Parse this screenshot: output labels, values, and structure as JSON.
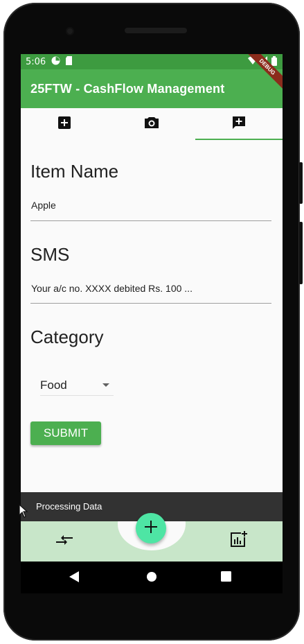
{
  "status_bar": {
    "time": "5:06",
    "icons": [
      "pie-icon",
      "sim-icon",
      "wifi-icon",
      "signal-icon",
      "battery-icon"
    ]
  },
  "app_bar": {
    "title": "25FTW - CashFlow Management",
    "debug_label": "DEBUG"
  },
  "tabs": [
    {
      "icon": "add-box-icon",
      "selected": false
    },
    {
      "icon": "camera-icon",
      "selected": false
    },
    {
      "icon": "add-comment-icon",
      "selected": true
    }
  ],
  "form": {
    "item_name": {
      "label": "Item Name",
      "value": "Apple"
    },
    "sms": {
      "label": "SMS",
      "value": "Your a/c no. XXXX debited Rs. 100 ..."
    },
    "category": {
      "label": "Category",
      "selected": "Food"
    },
    "submit_label": "SUBMIT"
  },
  "snackbar": {
    "text": "Processing Data"
  },
  "bottom_bar": {
    "left_icon": "compare-arrows-icon",
    "fab_icon": "add-icon",
    "right_icon": "add-chart-icon"
  },
  "nav_bar": {
    "icons": [
      "back-icon",
      "home-icon",
      "recents-icon"
    ]
  },
  "colors": {
    "primary": "#4caf50",
    "status_bar": "#3d9b40",
    "fab": "#4ee5a4",
    "bottom_bar": "#c8e6c9",
    "snackbar": "#323232"
  }
}
